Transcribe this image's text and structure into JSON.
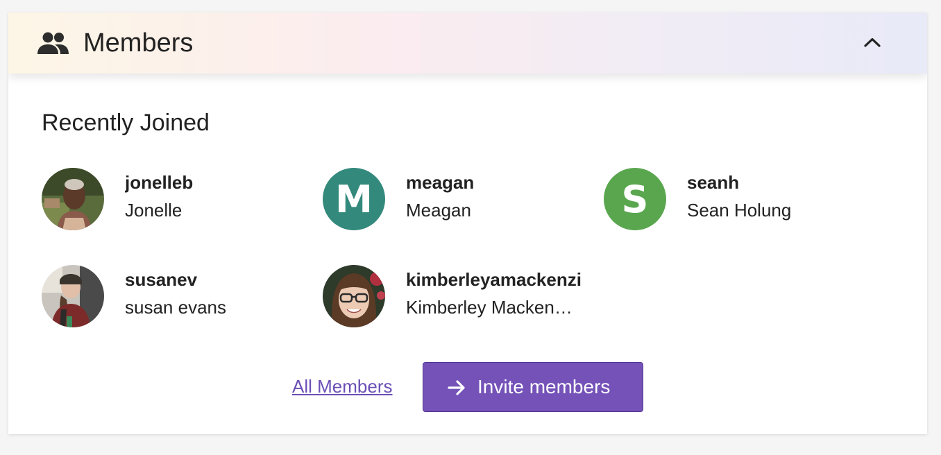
{
  "header": {
    "title": "Members",
    "icon": "people-icon",
    "collapse_icon": "chevron-up-icon"
  },
  "section": {
    "title": "Recently Joined"
  },
  "members": [
    {
      "username": "jonelleb",
      "name": "Jonelle",
      "avatar": "photo"
    },
    {
      "username": "meagan",
      "name": "Meagan",
      "avatar": "letter",
      "letter": "M",
      "color": "#33897c"
    },
    {
      "username": "seanh",
      "name": "Sean Holung",
      "avatar": "letter",
      "letter": "S",
      "color": "#5aa64f"
    },
    {
      "username": "susanev",
      "name": "susan evans",
      "avatar": "photo"
    },
    {
      "username": "kimberleyamackenzi",
      "name": "Kimberley Macken…",
      "avatar": "photo"
    }
  ],
  "footer": {
    "all_members_label": "All Members",
    "invite_label": "Invite members",
    "invite_icon": "arrow-right-icon"
  },
  "colors": {
    "accent": "#7452b8",
    "link": "#6b4fb6"
  }
}
